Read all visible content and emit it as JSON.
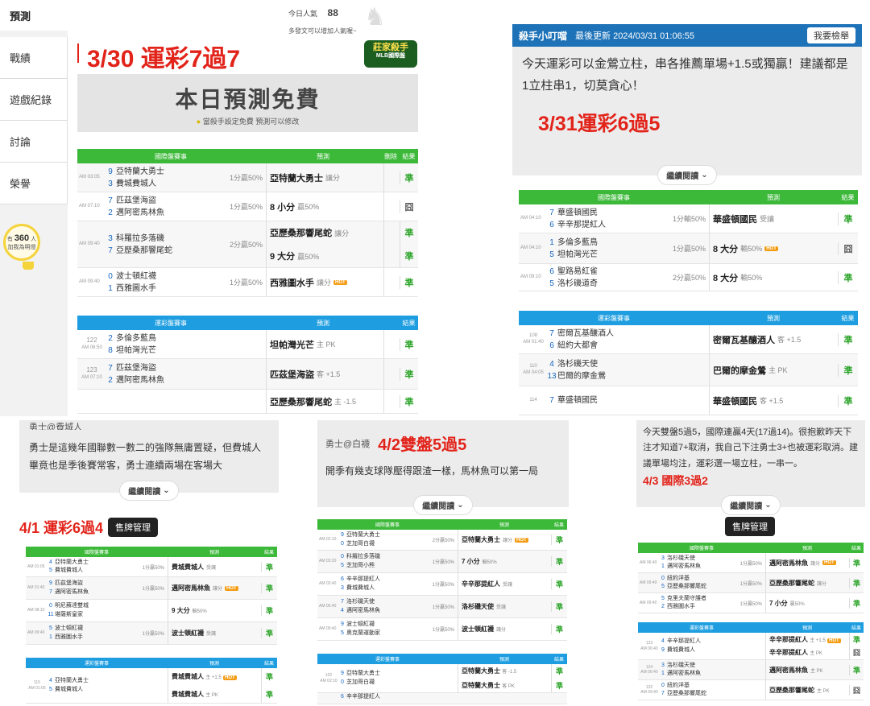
{
  "p1": {
    "tab": "預測",
    "popularity_label": "今日人氣",
    "popularity_value": "88",
    "post_hint": "多發文可以增加人氣喔~",
    "headline": "3/30 運彩7過7",
    "badge_line1": "殺手",
    "badge_line2": "MLB國際盤",
    "badge_sub": "莊家",
    "free_title": "本日預測免費",
    "free_sub": "當殺手設定免費 預測可以修改",
    "sidebar": [
      "戰績",
      "遊戲紀錄",
      "討論",
      "榮譽"
    ],
    "bulb_prefix": "有",
    "bulb_count": "360",
    "bulb_suffix": "人",
    "bulb_line2": "加我為明燈",
    "intl_header": [
      "國際盤賽事",
      "預測",
      "刪除",
      "結果"
    ],
    "intl_rows": [
      {
        "time": "AM 03:05",
        "n1": "9",
        "n2": "3",
        "t1": "亞特蘭大勇士",
        "t2": "費城費城人",
        "odds": "1分贏50%",
        "pick": "亞特蘭大勇士",
        "tag": "讓分",
        "res": "準"
      },
      {
        "time": "AM 07:10",
        "n1": "7",
        "n2": "2",
        "t1": "匹茲堡海盜",
        "t2": "邁阿密馬林魚",
        "odds": "1分贏50%",
        "pick": "8 小分",
        "tag": "贏50%",
        "res": "囧"
      },
      {
        "time": "AM 09:40",
        "n1": "3",
        "n2": "7",
        "t1": "科羅拉多落磯",
        "t2": "亞歷桑那響尾蛇",
        "odds": "2分贏50%",
        "pick": "亞歷桑那響尾蛇",
        "tag": "讓分",
        "pick2": "9 大分",
        "tag2": "贏50%",
        "res": "準",
        "res2": "準"
      },
      {
        "time": "AM 09:40",
        "n1": "0",
        "n2": "1",
        "t1": "波士頓紅襪",
        "t2": "西雅圖水手",
        "odds": "1分贏50%",
        "pick": "西雅圖水手",
        "tag": "讓分",
        "res": "準"
      }
    ],
    "sport_header": [
      "運彩盤賽事",
      "預測",
      "結果"
    ],
    "sport_rows": [
      {
        "no": "122",
        "time": "AM 06:50",
        "n1": "2",
        "n2": "8",
        "t1": "多倫多藍鳥",
        "t2": "坦帕灣光芒",
        "pick": "坦帕灣光芒",
        "tag": "主 PK",
        "res": "準"
      },
      {
        "no": "123",
        "time": "AM 07:10",
        "n1": "7",
        "n2": "2",
        "t1": "匹茲堡海盜",
        "t2": "邁阿密馬林魚",
        "pick": "匹茲堡海盜",
        "tag": "客 +1.5",
        "res": "準"
      },
      {
        "no": "",
        "time": "",
        "n1": "",
        "n2": "",
        "t1": "",
        "t2": "",
        "pick": "亞歷桑那響尾蛇",
        "tag": "主 -1.5",
        "res": "準"
      }
    ]
  },
  "p2": {
    "author": "殺手小叮噹",
    "updated": "最後更新 2024/03/31 01:06:55",
    "report": "我要檢舉",
    "body": "今天運彩可以金鶯立柱，串各推薦單場+1.5或獨贏！建議都是1立柱串1，切莫貪心！",
    "headline": "3/31運彩6過5",
    "more": "繼續閱讀",
    "intl_header": [
      "國際盤賽事",
      "預測",
      "結果"
    ],
    "intl_rows": [
      {
        "time": "AM 04:10",
        "n1": "7",
        "n2": "6",
        "t1": "華盛頓國民",
        "t2": "辛辛那提紅人",
        "odds": "1分輸50%",
        "pick": "華盛頓國民",
        "tag": "受讓",
        "res": "準"
      },
      {
        "time": "AM 04:10",
        "n1": "1",
        "n2": "5",
        "t1": "多倫多藍鳥",
        "t2": "坦帕灣光芒",
        "odds": "1分贏50%",
        "pick": "8 大分",
        "tag": "輸50%",
        "res": "囧"
      },
      {
        "time": "AM 09:10",
        "n1": "6",
        "n2": "5",
        "t1": "聖路易紅雀",
        "t2": "洛杉磯道奇",
        "odds": "2分贏50%",
        "pick": "8 大分",
        "tag": "輸50%",
        "res": "準"
      }
    ],
    "sport_header": [
      "運彩盤賽事",
      "預測",
      "結果"
    ],
    "sport_rows": [
      {
        "no": "108",
        "time": "AM 01:40",
        "n1": "7",
        "n2": "6",
        "t1": "密爾瓦基釀酒人",
        "t2": "紐約大都會",
        "pick": "密爾瓦基釀酒人",
        "tag": "客 +1.5",
        "res": "準"
      },
      {
        "no": "110",
        "time": "AM 04:05",
        "n1": "4",
        "n2": "13",
        "t1": "洛杉磯天使",
        "t2": "巴爾的摩金鶯",
        "pick": "巴爾的摩金鶯",
        "tag": "主 PK",
        "res": "準"
      },
      {
        "no": "114",
        "time": "",
        "n1": "7",
        "n2": "",
        "t1": "華盛頓國民",
        "t2": "",
        "pick": "華盛頓國民",
        "tag": "客 +1.5",
        "res": "準"
      }
    ]
  },
  "p3": {
    "top": "勇士@費城人",
    "body": "勇士是這幾年國聯數一數二的強隊無庸置疑，但費城人畢竟也是季後賽常客，勇士連續兩場在客場大",
    "more": "繼續閱讀",
    "headline": "4/1 運彩6過4",
    "manage": "售牌管理",
    "intl_header": [
      "國際盤賽事",
      "預測",
      "結果"
    ],
    "intl_rows": [
      {
        "time": "AM 01:05",
        "n1": "4",
        "n2": "5",
        "t1": "亞特蘭大勇士",
        "t2": "費城費城人",
        "odds": "1分贏50%",
        "pick": "費城費城人",
        "tag": "受讓",
        "res": "準"
      },
      {
        "time": "AM 01:40",
        "n1": "9",
        "n2": "7",
        "t1": "匹茲堡海盜",
        "t2": "邁阿密馬林魚",
        "odds": "1分贏50%",
        "pick": "邁阿密馬林魚",
        "tag": "讓分",
        "res": "準"
      },
      {
        "time": "AM 08:10",
        "n1": "0",
        "n2": "11",
        "t1": "明尼蘇達雙城",
        "t2": "堪薩斯皇家",
        "odds": "",
        "pick": "9 大分",
        "tag": "輸50%",
        "res": "準"
      },
      {
        "time": "AM 09:40",
        "n1": "5",
        "n2": "1",
        "t1": "波士頓紅襪",
        "t2": "西雅圖水手",
        "odds": "1分贏50%",
        "pick": "波士頓紅襪",
        "tag": "受讓",
        "res": "準"
      }
    ],
    "sport_header": [
      "運彩盤賽事",
      "預測",
      "結果"
    ],
    "sport_rows": [
      {
        "no": "115",
        "time": "AM 01:05",
        "n1": "4",
        "n2": "5",
        "t1": "亞特蘭大勇士",
        "t2": "費城費城人",
        "pick": "費城費城人",
        "tag": "主 +1.5",
        "pick2": "費城費城人",
        "tag2": "主 PK",
        "res": "準",
        "res2": "準"
      }
    ]
  },
  "p4": {
    "top": "勇士@白襪",
    "headline": "4/2雙盤5過5",
    "body": "開季有幾支球隊壓得跟渣一樣，馬林魚可以第一局",
    "more": "繼續閱讀",
    "intl_header": [
      "國際盤賽事",
      "預測",
      "結果"
    ],
    "intl_rows": [
      {
        "time": "AM 02:10",
        "n1": "9",
        "n2": "0",
        "t1": "亞特蘭大勇士",
        "t2": "芝加哥白襪",
        "odds": "2分贏50%",
        "pick": "亞特蘭大勇士",
        "tag": "讓分",
        "res": "準"
      },
      {
        "time": "AM 03:20",
        "n1": "0",
        "n2": "5",
        "t1": "科羅拉多落磯",
        "t2": "芝加哥小熊",
        "odds": "1分贏50%",
        "pick": "7 小分",
        "tag": "輸50%",
        "res": "準"
      },
      {
        "time": "AM 03:40",
        "n1": "6",
        "n2": "3",
        "t1": "辛辛那提紅人",
        "t2": "費城費城人",
        "odds": "1分贏50%",
        "pick": "辛辛那提紅人",
        "tag": "受讓",
        "res": "準"
      },
      {
        "time": "AM 06:40",
        "n1": "7",
        "n2": "4",
        "t1": "洛杉磯天使",
        "t2": "邁阿密馬林魚",
        "odds": "1分贏50%",
        "pick": "洛杉磯天使",
        "tag": "受讓",
        "res": "準"
      },
      {
        "time": "AM 09:40",
        "n1": "9",
        "n2": "5",
        "t1": "波士頓紅襪",
        "t2": "奧克蘭運動家",
        "odds": "1分贏50%",
        "pick": "波士頓紅襪",
        "tag": "讓分",
        "res": "準"
      }
    ],
    "sport_header": [
      "運彩盤賽事",
      "預測",
      "結果"
    ],
    "sport_rows": [
      {
        "no": "102",
        "time": "AM 02:10",
        "n1": "9",
        "n2": "0",
        "t1": "亞特蘭大勇士",
        "t2": "芝加哥白襪",
        "pick": "亞特蘭大勇士",
        "tag": "客 -1.5",
        "pick2": "亞特蘭大勇士",
        "tag2": "客 PK",
        "res": "準",
        "res2": "準"
      },
      {
        "no": "",
        "time": "",
        "n1": "6",
        "n2": "",
        "t1": "辛辛那提紅人",
        "t2": "",
        "pick": "",
        "tag": "",
        "res": ""
      }
    ]
  },
  "p5": {
    "body": "今天雙盤5過5，國際連贏4天(17過14)。很抱歉昨天下注才知道7+取消，我自己下注勇士3+也被運彩取消。建議單場均注，運彩選一場立柱，一串一。",
    "headline": "4/3 國際3過2",
    "more": "繼續閱讀",
    "manage": "售牌管理",
    "intl_header": [
      "國際盤賽事",
      "預測",
      "結果"
    ],
    "intl_rows": [
      {
        "time": "AM 06:40",
        "n1": "3",
        "n2": "1",
        "t1": "洛杉磯天使",
        "t2": "邁阿密馬林魚",
        "odds": "1分贏50%",
        "pick": "邁阿密馬林魚",
        "tag": "讓分",
        "res": "準"
      },
      {
        "time": "AM 09:40",
        "n1": "0",
        "n2": "5",
        "t1": "紐約洋基",
        "t2": "亞歷桑那響尾蛇",
        "odds": "1分贏50%",
        "pick": "亞歷桑那響尾蛇",
        "tag": "讓分",
        "res": "準"
      },
      {
        "time": "AM 09:40",
        "n1": "5",
        "n2": "2",
        "t1": "克里夫蘭守護者",
        "t2": "西雅圖水手",
        "odds": "1分贏50%",
        "pick": "7 小分",
        "tag": "贏50%",
        "res": "準"
      }
    ],
    "sport_header": [
      "運彩盤賽事",
      "預測",
      "結果"
    ],
    "sport_rows": [
      {
        "no": "123",
        "time": "AM 06:40",
        "n1": "4",
        "n2": "9",
        "t1": "辛辛那提紅人",
        "t2": "費城費城人",
        "pick": "辛辛那提紅人",
        "tag": "主 +1.5",
        "pick2": "辛辛那提紅人",
        "tag2": "主 PK",
        "res": "準",
        "res2": "囧"
      },
      {
        "no": "124",
        "time": "AM 06:40",
        "n1": "3",
        "n2": "1",
        "t1": "洛杉磯天使",
        "t2": "邁阿密馬林魚",
        "pick": "邁阿密馬林魚",
        "tag": "主 PK",
        "res": "準"
      },
      {
        "no": "132",
        "time": "AM 09:40",
        "n1": "0",
        "n2": "7",
        "t1": "紐約洋基",
        "t2": "亞歷桑那響尾蛇",
        "pick": "亞歷桑那響尾蛇",
        "tag": "主 PK",
        "res": "囧"
      }
    ]
  }
}
